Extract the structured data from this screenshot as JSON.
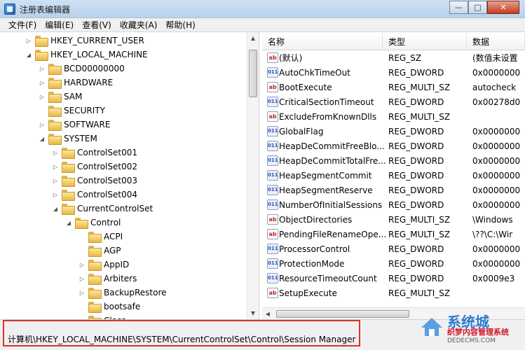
{
  "window": {
    "title": "注册表编辑器",
    "min_glyph": "—",
    "max_glyph": "□",
    "close_glyph": "✕"
  },
  "menu": [
    "文件(F)",
    "编辑(E)",
    "查看(V)",
    "收藏夹(A)",
    "帮助(H)"
  ],
  "tree": [
    {
      "label": "HKEY_CURRENT_USER",
      "level": 0,
      "expander": "collapsed"
    },
    {
      "label": "HKEY_LOCAL_MACHINE",
      "level": 0,
      "expander": "expanded"
    },
    {
      "label": "BCD00000000",
      "level": 1,
      "expander": "collapsed"
    },
    {
      "label": "HARDWARE",
      "level": 1,
      "expander": "collapsed"
    },
    {
      "label": "SAM",
      "level": 1,
      "expander": "collapsed"
    },
    {
      "label": "SECURITY",
      "level": 1,
      "expander": "none"
    },
    {
      "label": "SOFTWARE",
      "level": 1,
      "expander": "collapsed"
    },
    {
      "label": "SYSTEM",
      "level": 1,
      "expander": "expanded"
    },
    {
      "label": "ControlSet001",
      "level": 2,
      "expander": "collapsed"
    },
    {
      "label": "ControlSet002",
      "level": 2,
      "expander": "collapsed"
    },
    {
      "label": "ControlSet003",
      "level": 2,
      "expander": "collapsed"
    },
    {
      "label": "ControlSet004",
      "level": 2,
      "expander": "collapsed"
    },
    {
      "label": "CurrentControlSet",
      "level": 2,
      "expander": "expanded"
    },
    {
      "label": "Control",
      "level": 3,
      "expander": "expanded"
    },
    {
      "label": "ACPI",
      "level": 4,
      "expander": "none"
    },
    {
      "label": "AGP",
      "level": 4,
      "expander": "none"
    },
    {
      "label": "AppID",
      "level": 4,
      "expander": "collapsed"
    },
    {
      "label": "Arbiters",
      "level": 4,
      "expander": "collapsed"
    },
    {
      "label": "BackupRestore",
      "level": 4,
      "expander": "collapsed"
    },
    {
      "label": "bootsafe",
      "level": 4,
      "expander": "none"
    },
    {
      "label": "Class",
      "level": 4,
      "expander": "collapsed"
    }
  ],
  "list": {
    "headers": {
      "name": "名称",
      "type": "类型",
      "data": "数据"
    },
    "rows": [
      {
        "icon": "ab",
        "name": "(默认)",
        "type": "REG_SZ",
        "data": "(数值未设置"
      },
      {
        "icon": "bin",
        "name": "AutoChkTimeOut",
        "type": "REG_DWORD",
        "data": "0x0000000"
      },
      {
        "icon": "ab",
        "name": "BootExecute",
        "type": "REG_MULTI_SZ",
        "data": "autocheck"
      },
      {
        "icon": "bin",
        "name": "CriticalSectionTimeout",
        "type": "REG_DWORD",
        "data": "0x00278d0"
      },
      {
        "icon": "ab",
        "name": "ExcludeFromKnownDlls",
        "type": "REG_MULTI_SZ",
        "data": ""
      },
      {
        "icon": "bin",
        "name": "GlobalFlag",
        "type": "REG_DWORD",
        "data": "0x0000000"
      },
      {
        "icon": "bin",
        "name": "HeapDeCommitFreeBlo...",
        "type": "REG_DWORD",
        "data": "0x0000000"
      },
      {
        "icon": "bin",
        "name": "HeapDeCommitTotalFre...",
        "type": "REG_DWORD",
        "data": "0x0000000"
      },
      {
        "icon": "bin",
        "name": "HeapSegmentCommit",
        "type": "REG_DWORD",
        "data": "0x0000000"
      },
      {
        "icon": "bin",
        "name": "HeapSegmentReserve",
        "type": "REG_DWORD",
        "data": "0x0000000"
      },
      {
        "icon": "bin",
        "name": "NumberOfInitialSessions",
        "type": "REG_DWORD",
        "data": "0x0000000"
      },
      {
        "icon": "ab",
        "name": "ObjectDirectories",
        "type": "REG_MULTI_SZ",
        "data": "\\Windows"
      },
      {
        "icon": "ab",
        "name": "PendingFileRenameOpe...",
        "type": "REG_MULTI_SZ",
        "data": "\\??\\C:\\Wir"
      },
      {
        "icon": "bin",
        "name": "ProcessorControl",
        "type": "REG_DWORD",
        "data": "0x0000000"
      },
      {
        "icon": "bin",
        "name": "ProtectionMode",
        "type": "REG_DWORD",
        "data": "0x0000000"
      },
      {
        "icon": "bin",
        "name": "ResourceTimeoutCount",
        "type": "REG_DWORD",
        "data": "0x0009e3"
      },
      {
        "icon": "ab",
        "name": "SetupExecute",
        "type": "REG_MULTI_SZ",
        "data": ""
      }
    ]
  },
  "status": {
    "path": "计算机\\HKEY_LOCAL_MACHINE\\SYSTEM\\CurrentControlSet\\Control\\Session Manager"
  },
  "watermark": {
    "big": "系统城",
    "mid": "织梦内容管理系统",
    "small": "DEDECMS.COM"
  },
  "icon_glyphs": {
    "ab": "ab",
    "bin": "011"
  }
}
